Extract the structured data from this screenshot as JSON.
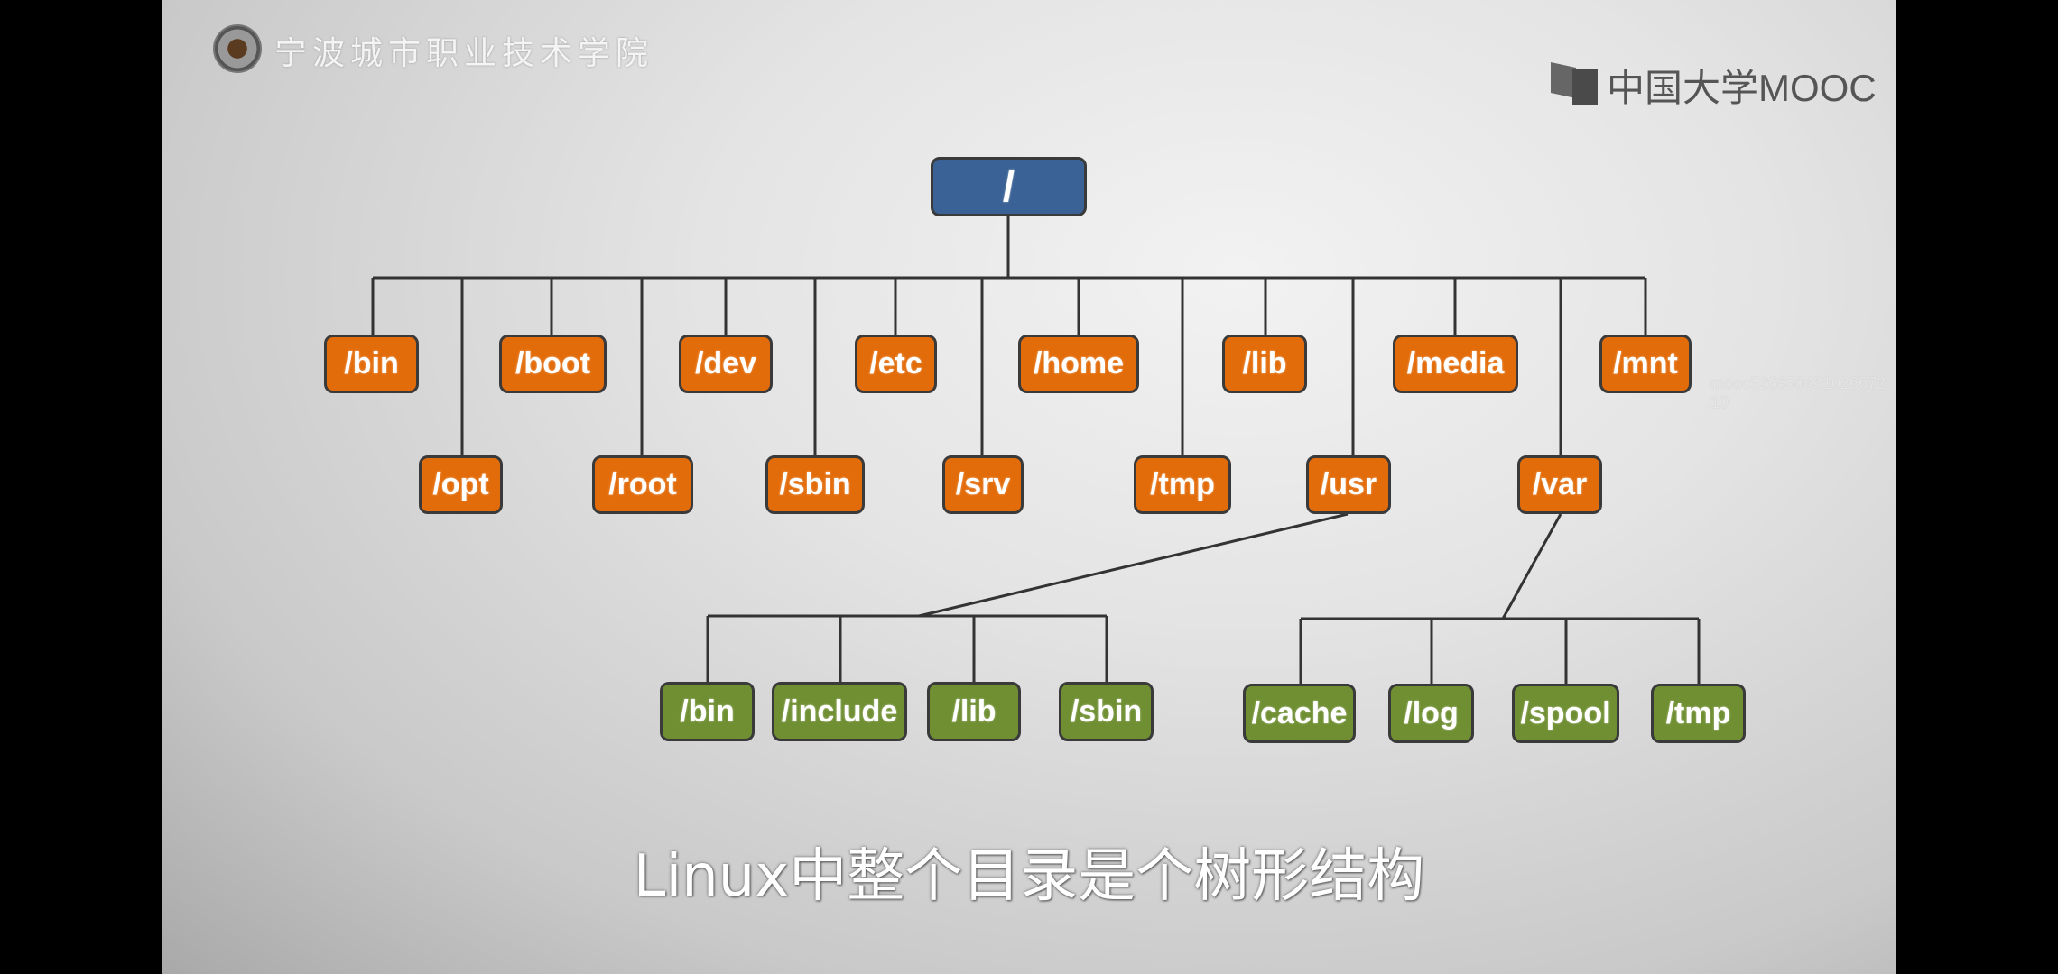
{
  "branding": {
    "school_name": "宁波城市职业技术学院",
    "platform_logo": "中国大学MOOC",
    "watermark": "mooc526850431026672​10"
  },
  "colors": {
    "root": "#3a6296",
    "level1": "#e36c0a",
    "level2": "#6f8f32",
    "line": "#333333"
  },
  "tree": {
    "root": "/",
    "level1_top": [
      "/bin",
      "/boot",
      "/dev",
      "/etc",
      "/home",
      "/lib",
      "/media",
      "/mnt"
    ],
    "level1_bottom": [
      "/opt",
      "/root",
      "/sbin",
      "/srv",
      "/tmp",
      "/usr",
      "/var"
    ],
    "usr_children": [
      "/bin",
      "/include",
      "/lib",
      "/sbin"
    ],
    "var_children": [
      "/cache",
      "/log",
      "/spool",
      "/tmp"
    ]
  },
  "subtitle": "Linux中整个目录是个树形结构"
}
